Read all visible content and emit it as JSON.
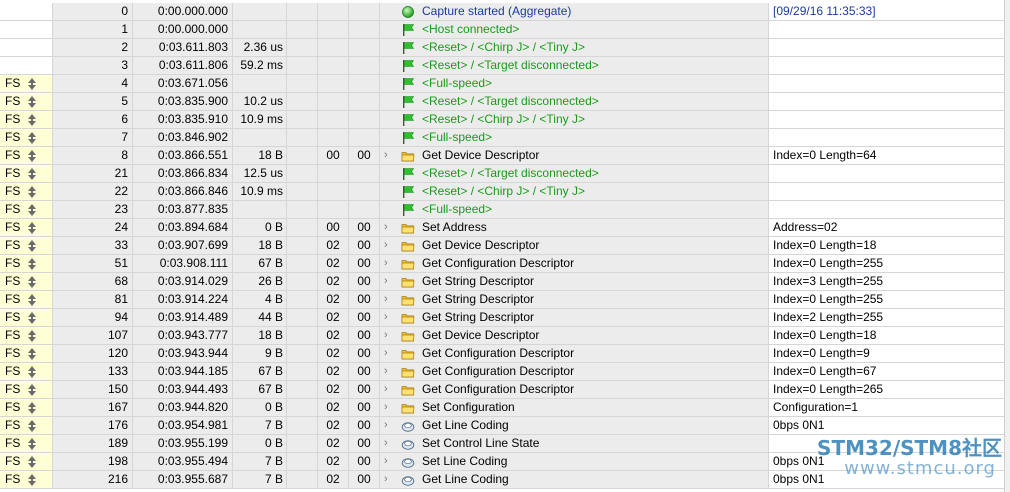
{
  "rows": [
    {
      "speed": "",
      "index": "0",
      "time": "0:00.000.000",
      "dur": "",
      "dev": "",
      "ep": "",
      "icon": "green-dot",
      "expander": false,
      "record": "Capture started (Aggregate)",
      "style": "blue",
      "summary": "[09/29/16 11:35:33]"
    },
    {
      "speed": "",
      "index": "1",
      "time": "0:00.000.000",
      "dur": "",
      "dev": "",
      "ep": "",
      "icon": "flag",
      "expander": false,
      "record": "<Host connected>",
      "style": "green",
      "summary": ""
    },
    {
      "speed": "",
      "index": "2",
      "time": "0:03.611.803",
      "dur": "2.36 us",
      "dev": "",
      "ep": "",
      "icon": "flag",
      "expander": false,
      "record": "<Reset> / <Chirp J> / <Tiny J>",
      "style": "green",
      "summary": ""
    },
    {
      "speed": "",
      "index": "3",
      "time": "0:03.611.806",
      "dur": "59.2 ms",
      "dev": "",
      "ep": "",
      "icon": "flag",
      "expander": false,
      "record": "<Reset> / <Target disconnected>",
      "style": "green",
      "summary": ""
    },
    {
      "speed": "FS",
      "index": "4",
      "time": "0:03.671.056",
      "dur": "",
      "dev": "",
      "ep": "",
      "icon": "flag",
      "expander": false,
      "record": "<Full-speed>",
      "style": "green",
      "summary": ""
    },
    {
      "speed": "FS",
      "index": "5",
      "time": "0:03.835.900",
      "dur": "10.2 us",
      "dev": "",
      "ep": "",
      "icon": "flag",
      "expander": false,
      "record": "<Reset> / <Target disconnected>",
      "style": "green",
      "summary": ""
    },
    {
      "speed": "FS",
      "index": "6",
      "time": "0:03.835.910",
      "dur": "10.9 ms",
      "dev": "",
      "ep": "",
      "icon": "flag",
      "expander": false,
      "record": "<Reset> / <Chirp J> / <Tiny J>",
      "style": "green",
      "summary": ""
    },
    {
      "speed": "FS",
      "index": "7",
      "time": "0:03.846.902",
      "dur": "",
      "dev": "",
      "ep": "",
      "icon": "flag",
      "expander": false,
      "record": "<Full-speed>",
      "style": "green",
      "summary": ""
    },
    {
      "speed": "FS",
      "index": "8",
      "time": "0:03.866.551",
      "dur": "18 B",
      "dev": "00",
      "ep": "00",
      "icon": "folder",
      "expander": true,
      "record": "Get Device Descriptor",
      "style": "black",
      "summary": "Index=0 Length=64"
    },
    {
      "speed": "FS",
      "index": "21",
      "time": "0:03.866.834",
      "dur": "12.5 us",
      "dev": "",
      "ep": "",
      "icon": "flag",
      "expander": false,
      "record": "<Reset> / <Target disconnected>",
      "style": "green",
      "summary": ""
    },
    {
      "speed": "FS",
      "index": "22",
      "time": "0:03.866.846",
      "dur": "10.9 ms",
      "dev": "",
      "ep": "",
      "icon": "flag",
      "expander": false,
      "record": "<Reset> / <Chirp J> / <Tiny J>",
      "style": "green",
      "summary": ""
    },
    {
      "speed": "FS",
      "index": "23",
      "time": "0:03.877.835",
      "dur": "",
      "dev": "",
      "ep": "",
      "icon": "flag",
      "expander": false,
      "record": "<Full-speed>",
      "style": "green",
      "summary": ""
    },
    {
      "speed": "FS",
      "index": "24",
      "time": "0:03.894.684",
      "dur": "0 B",
      "dev": "00",
      "ep": "00",
      "icon": "folder",
      "expander": true,
      "record": "Set Address",
      "style": "black",
      "summary": "Address=02"
    },
    {
      "speed": "FS",
      "index": "33",
      "time": "0:03.907.699",
      "dur": "18 B",
      "dev": "02",
      "ep": "00",
      "icon": "folder",
      "expander": true,
      "record": "Get Device Descriptor",
      "style": "black",
      "summary": "Index=0 Length=18"
    },
    {
      "speed": "FS",
      "index": "51",
      "time": "0:03.908.111",
      "dur": "67 B",
      "dev": "02",
      "ep": "00",
      "icon": "folder",
      "expander": true,
      "record": "Get Configuration Descriptor",
      "style": "black",
      "summary": "Index=0 Length=255"
    },
    {
      "speed": "FS",
      "index": "68",
      "time": "0:03.914.029",
      "dur": "26 B",
      "dev": "02",
      "ep": "00",
      "icon": "folder",
      "expander": true,
      "record": "Get String Descriptor",
      "style": "black",
      "summary": "Index=3 Length=255"
    },
    {
      "speed": "FS",
      "index": "81",
      "time": "0:03.914.224",
      "dur": "4 B",
      "dev": "02",
      "ep": "00",
      "icon": "folder",
      "expander": true,
      "record": "Get String Descriptor",
      "style": "black",
      "summary": "Index=0 Length=255"
    },
    {
      "speed": "FS",
      "index": "94",
      "time": "0:03.914.489",
      "dur": "44 B",
      "dev": "02",
      "ep": "00",
      "icon": "folder",
      "expander": true,
      "record": "Get String Descriptor",
      "style": "black",
      "summary": "Index=2 Length=255"
    },
    {
      "speed": "FS",
      "index": "107",
      "time": "0:03.943.777",
      "dur": "18 B",
      "dev": "02",
      "ep": "00",
      "icon": "folder",
      "expander": true,
      "record": "Get Device Descriptor",
      "style": "black",
      "summary": "Index=0 Length=18"
    },
    {
      "speed": "FS",
      "index": "120",
      "time": "0:03.943.944",
      "dur": "9 B",
      "dev": "02",
      "ep": "00",
      "icon": "folder",
      "expander": true,
      "record": "Get Configuration Descriptor",
      "style": "black",
      "summary": "Index=0 Length=9"
    },
    {
      "speed": "FS",
      "index": "133",
      "time": "0:03.944.185",
      "dur": "67 B",
      "dev": "02",
      "ep": "00",
      "icon": "folder",
      "expander": true,
      "record": "Get Configuration Descriptor",
      "style": "black",
      "summary": "Index=0 Length=67"
    },
    {
      "speed": "FS",
      "index": "150",
      "time": "0:03.944.493",
      "dur": "67 B",
      "dev": "02",
      "ep": "00",
      "icon": "folder",
      "expander": true,
      "record": "Get Configuration Descriptor",
      "style": "black",
      "summary": "Index=0 Length=265"
    },
    {
      "speed": "FS",
      "index": "167",
      "time": "0:03.944.820",
      "dur": "0 B",
      "dev": "02",
      "ep": "00",
      "icon": "folder",
      "expander": true,
      "record": "Set Configuration",
      "style": "black",
      "summary": "Configuration=1"
    },
    {
      "speed": "FS",
      "index": "176",
      "time": "0:03.954.981",
      "dur": "7 B",
      "dev": "02",
      "ep": "00",
      "icon": "class",
      "expander": true,
      "record": "Get Line Coding",
      "style": "black",
      "summary": "0bps 0N1"
    },
    {
      "speed": "FS",
      "index": "189",
      "time": "0:03.955.199",
      "dur": "0 B",
      "dev": "02",
      "ep": "00",
      "icon": "class",
      "expander": true,
      "record": "Set Control Line State",
      "style": "black",
      "summary": ""
    },
    {
      "speed": "FS",
      "index": "198",
      "time": "0:03.955.494",
      "dur": "7 B",
      "dev": "02",
      "ep": "00",
      "icon": "class",
      "expander": true,
      "record": "Set Line Coding",
      "style": "black",
      "summary": "0bps 0N1"
    },
    {
      "speed": "FS",
      "index": "216",
      "time": "0:03.955.687",
      "dur": "7 B",
      "dev": "02",
      "ep": "00",
      "icon": "class",
      "expander": true,
      "record": "Get Line Coding",
      "style": "black",
      "summary": "0bps 0N1"
    }
  ],
  "watermark": {
    "title": "STM32/STM8社区",
    "url": "www.stmcu.org"
  },
  "colors": {
    "speed_bg": "#ffffd5",
    "cell_bg": "#ececec",
    "green_text": "#1a9a1a",
    "blue_text": "#1a3aa0",
    "watermark": "#2e7fb6"
  }
}
